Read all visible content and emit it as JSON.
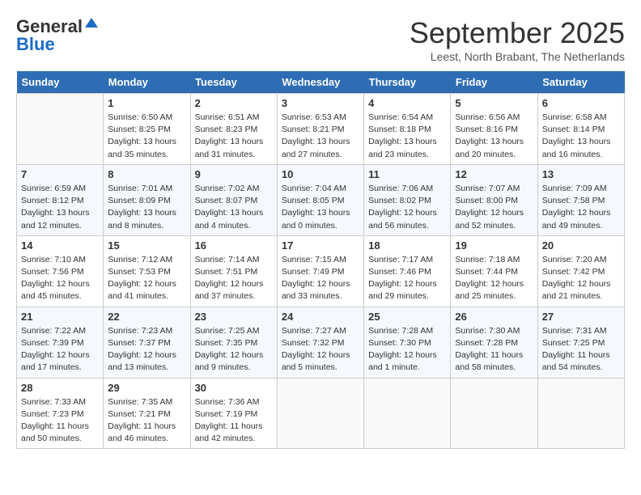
{
  "header": {
    "logo_line1": "General",
    "logo_line2": "Blue",
    "month": "September 2025",
    "location": "Leest, North Brabant, The Netherlands"
  },
  "weekdays": [
    "Sunday",
    "Monday",
    "Tuesday",
    "Wednesday",
    "Thursday",
    "Friday",
    "Saturday"
  ],
  "weeks": [
    [
      {
        "day": "",
        "info": ""
      },
      {
        "day": "1",
        "info": "Sunrise: 6:50 AM\nSunset: 8:25 PM\nDaylight: 13 hours\nand 35 minutes."
      },
      {
        "day": "2",
        "info": "Sunrise: 6:51 AM\nSunset: 8:23 PM\nDaylight: 13 hours\nand 31 minutes."
      },
      {
        "day": "3",
        "info": "Sunrise: 6:53 AM\nSunset: 8:21 PM\nDaylight: 13 hours\nand 27 minutes."
      },
      {
        "day": "4",
        "info": "Sunrise: 6:54 AM\nSunset: 8:18 PM\nDaylight: 13 hours\nand 23 minutes."
      },
      {
        "day": "5",
        "info": "Sunrise: 6:56 AM\nSunset: 8:16 PM\nDaylight: 13 hours\nand 20 minutes."
      },
      {
        "day": "6",
        "info": "Sunrise: 6:58 AM\nSunset: 8:14 PM\nDaylight: 13 hours\nand 16 minutes."
      }
    ],
    [
      {
        "day": "7",
        "info": "Sunrise: 6:59 AM\nSunset: 8:12 PM\nDaylight: 13 hours\nand 12 minutes."
      },
      {
        "day": "8",
        "info": "Sunrise: 7:01 AM\nSunset: 8:09 PM\nDaylight: 13 hours\nand 8 minutes."
      },
      {
        "day": "9",
        "info": "Sunrise: 7:02 AM\nSunset: 8:07 PM\nDaylight: 13 hours\nand 4 minutes."
      },
      {
        "day": "10",
        "info": "Sunrise: 7:04 AM\nSunset: 8:05 PM\nDaylight: 13 hours\nand 0 minutes."
      },
      {
        "day": "11",
        "info": "Sunrise: 7:06 AM\nSunset: 8:02 PM\nDaylight: 12 hours\nand 56 minutes."
      },
      {
        "day": "12",
        "info": "Sunrise: 7:07 AM\nSunset: 8:00 PM\nDaylight: 12 hours\nand 52 minutes."
      },
      {
        "day": "13",
        "info": "Sunrise: 7:09 AM\nSunset: 7:58 PM\nDaylight: 12 hours\nand 49 minutes."
      }
    ],
    [
      {
        "day": "14",
        "info": "Sunrise: 7:10 AM\nSunset: 7:56 PM\nDaylight: 12 hours\nand 45 minutes."
      },
      {
        "day": "15",
        "info": "Sunrise: 7:12 AM\nSunset: 7:53 PM\nDaylight: 12 hours\nand 41 minutes."
      },
      {
        "day": "16",
        "info": "Sunrise: 7:14 AM\nSunset: 7:51 PM\nDaylight: 12 hours\nand 37 minutes."
      },
      {
        "day": "17",
        "info": "Sunrise: 7:15 AM\nSunset: 7:49 PM\nDaylight: 12 hours\nand 33 minutes."
      },
      {
        "day": "18",
        "info": "Sunrise: 7:17 AM\nSunset: 7:46 PM\nDaylight: 12 hours\nand 29 minutes."
      },
      {
        "day": "19",
        "info": "Sunrise: 7:18 AM\nSunset: 7:44 PM\nDaylight: 12 hours\nand 25 minutes."
      },
      {
        "day": "20",
        "info": "Sunrise: 7:20 AM\nSunset: 7:42 PM\nDaylight: 12 hours\nand 21 minutes."
      }
    ],
    [
      {
        "day": "21",
        "info": "Sunrise: 7:22 AM\nSunset: 7:39 PM\nDaylight: 12 hours\nand 17 minutes."
      },
      {
        "day": "22",
        "info": "Sunrise: 7:23 AM\nSunset: 7:37 PM\nDaylight: 12 hours\nand 13 minutes."
      },
      {
        "day": "23",
        "info": "Sunrise: 7:25 AM\nSunset: 7:35 PM\nDaylight: 12 hours\nand 9 minutes."
      },
      {
        "day": "24",
        "info": "Sunrise: 7:27 AM\nSunset: 7:32 PM\nDaylight: 12 hours\nand 5 minutes."
      },
      {
        "day": "25",
        "info": "Sunrise: 7:28 AM\nSunset: 7:30 PM\nDaylight: 12 hours\nand 1 minute."
      },
      {
        "day": "26",
        "info": "Sunrise: 7:30 AM\nSunset: 7:28 PM\nDaylight: 11 hours\nand 58 minutes."
      },
      {
        "day": "27",
        "info": "Sunrise: 7:31 AM\nSunset: 7:25 PM\nDaylight: 11 hours\nand 54 minutes."
      }
    ],
    [
      {
        "day": "28",
        "info": "Sunrise: 7:33 AM\nSunset: 7:23 PM\nDaylight: 11 hours\nand 50 minutes."
      },
      {
        "day": "29",
        "info": "Sunrise: 7:35 AM\nSunset: 7:21 PM\nDaylight: 11 hours\nand 46 minutes."
      },
      {
        "day": "30",
        "info": "Sunrise: 7:36 AM\nSunset: 7:19 PM\nDaylight: 11 hours\nand 42 minutes."
      },
      {
        "day": "",
        "info": ""
      },
      {
        "day": "",
        "info": ""
      },
      {
        "day": "",
        "info": ""
      },
      {
        "day": "",
        "info": ""
      }
    ]
  ]
}
